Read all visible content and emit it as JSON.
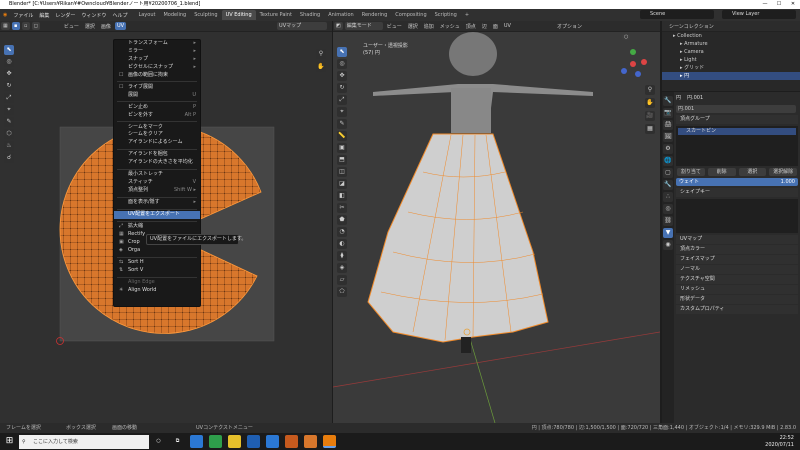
{
  "window": {
    "title": "Blender* [C:¥Users¥Rikan¥#Owncloud¥Blenderノート用¥20200706_1.blend]",
    "min": "—",
    "max": "☐",
    "close": "✕"
  },
  "menubar": {
    "menus": [
      "ファイル",
      "編集",
      "レンダー",
      "ウィンドウ",
      "ヘルプ"
    ],
    "workspaces": [
      "Layout",
      "Modeling",
      "Sculpting",
      "UV Editing",
      "Texture Paint",
      "Shading",
      "Animation",
      "Rendering",
      "Compositing",
      "Scripting"
    ],
    "active_workspace": "UV Editing",
    "scene_label": "Scene",
    "view_layer_label": "View Layer"
  },
  "uv_editor": {
    "header_items": [
      "ビュー",
      "選択",
      "画像",
      "UV"
    ],
    "image_field": "UVマップ",
    "menu": {
      "items": [
        {
          "label": "トランスフォーム",
          "sc": "▸",
          "type": "item"
        },
        {
          "label": "ミラー",
          "sc": "▸",
          "type": "item"
        },
        {
          "label": "スナップ",
          "sc": "▸",
          "type": "item"
        },
        {
          "label": "ピクセルにスナップ",
          "sc": "▸",
          "type": "item"
        },
        {
          "label": "画像の範囲に拘束",
          "sc": "",
          "type": "check"
        },
        {
          "type": "sep"
        },
        {
          "label": "ライブ展開",
          "sc": "",
          "type": "check"
        },
        {
          "label": "展開",
          "sc": "U",
          "type": "item"
        },
        {
          "type": "sep"
        },
        {
          "label": "ピン止め",
          "sc": "P",
          "type": "item"
        },
        {
          "label": "ピンを外す",
          "sc": "Alt P",
          "type": "item"
        },
        {
          "type": "sep"
        },
        {
          "label": "シームをマーク",
          "sc": "",
          "type": "item"
        },
        {
          "label": "シームをクリア",
          "sc": "",
          "type": "item"
        },
        {
          "label": "アイランドによるシーム",
          "sc": "",
          "type": "item"
        },
        {
          "type": "sep"
        },
        {
          "label": "アイランドを梱包",
          "sc": "",
          "type": "item"
        },
        {
          "label": "アイランドの大きさを平均化",
          "sc": "",
          "type": "item"
        },
        {
          "type": "sep"
        },
        {
          "label": "最小ストレッチ",
          "sc": "",
          "type": "item"
        },
        {
          "label": "スティッチ",
          "sc": "V",
          "type": "item"
        },
        {
          "label": "頂点整列",
          "sc": "Shift W ▸",
          "type": "item"
        },
        {
          "type": "sep"
        },
        {
          "label": "面を表示/隠す",
          "sc": "▸",
          "type": "item"
        },
        {
          "type": "sep"
        },
        {
          "label": "UV配置をエクスポート",
          "sc": "",
          "type": "hl"
        },
        {
          "type": "sep"
        },
        {
          "label": "拡大縮",
          "sc": "",
          "type": "icon",
          "icon": "⤢"
        },
        {
          "label": "Rectify",
          "sc": "",
          "type": "icon",
          "icon": "▦"
        },
        {
          "label": "Crop",
          "sc": "",
          "type": "icon",
          "icon": "▣"
        },
        {
          "label": "Orga",
          "sc": "",
          "type": "icon",
          "icon": "◈"
        },
        {
          "type": "sep"
        },
        {
          "label": "Sort H",
          "sc": "",
          "type": "icon",
          "icon": "⇆"
        },
        {
          "label": "Sort V",
          "sc": "",
          "type": "icon",
          "icon": "⇅"
        },
        {
          "type": "sep"
        },
        {
          "label": "Align Edge",
          "sc": "",
          "type": "dim"
        },
        {
          "label": "Align World",
          "sc": "",
          "type": "icon",
          "icon": "✳"
        }
      ]
    },
    "tooltip": "UV配置をファイルにエクスポートします。"
  },
  "viewport": {
    "header_items": [
      "編集モード",
      "ビュー",
      "選択",
      "追加",
      "メッシュ",
      "頂点",
      "辺",
      "面",
      "UV"
    ],
    "overlay_title": "ユーザー・透視投影",
    "overlay_object": "(57) 円",
    "option_label": "オプション"
  },
  "outliner": {
    "title": "シーンコレクション",
    "rows": [
      {
        "label": "Collection",
        "sel": false,
        "indent": 1
      },
      {
        "label": "Armature",
        "sel": false,
        "indent": 2
      },
      {
        "label": "Camera",
        "sel": false,
        "indent": 2
      },
      {
        "label": "Light",
        "sel": false,
        "indent": 2
      },
      {
        "label": "グリッド",
        "sel": false,
        "indent": 2
      },
      {
        "label": "円",
        "sel": true,
        "indent": 2
      }
    ]
  },
  "properties": {
    "object_name": "円",
    "mesh_name": "円.001",
    "data_name": "円.001",
    "vertex_groups_title": "頂点グループ",
    "vertex_group_item": "スカートピン",
    "buttons": [
      "割り当て",
      "削除",
      "選択",
      "選択解除"
    ],
    "weight_label": "ウェイト",
    "weight_value": "1.000",
    "shape_keys_title": "シェイプキー",
    "panels": [
      "UVマップ",
      "頂点カラー",
      "フェイスマップ",
      "ノーマル",
      "テクスチャ空間",
      "リメッシュ",
      "形状データ",
      "カスタムプロパティ"
    ]
  },
  "statusbar": {
    "left": [
      "フレームを選択",
      "ボックス選択",
      "画面の移動"
    ],
    "center": "UVコンテクストメニュー",
    "right": "円 | 頂点:780/780 | 辺:1,500/1,500 | 面:720/720 | 三角面:1,440 | オブジェクト:1/4 | メモリ:329.9 MiB | 2.83.0"
  },
  "taskbar": {
    "search_placeholder": "ここに入力して検索",
    "time": "22:52",
    "date": "2020/07/11"
  },
  "colors": {
    "uv_orange": "#d8772c",
    "accent": "#4772b3"
  }
}
